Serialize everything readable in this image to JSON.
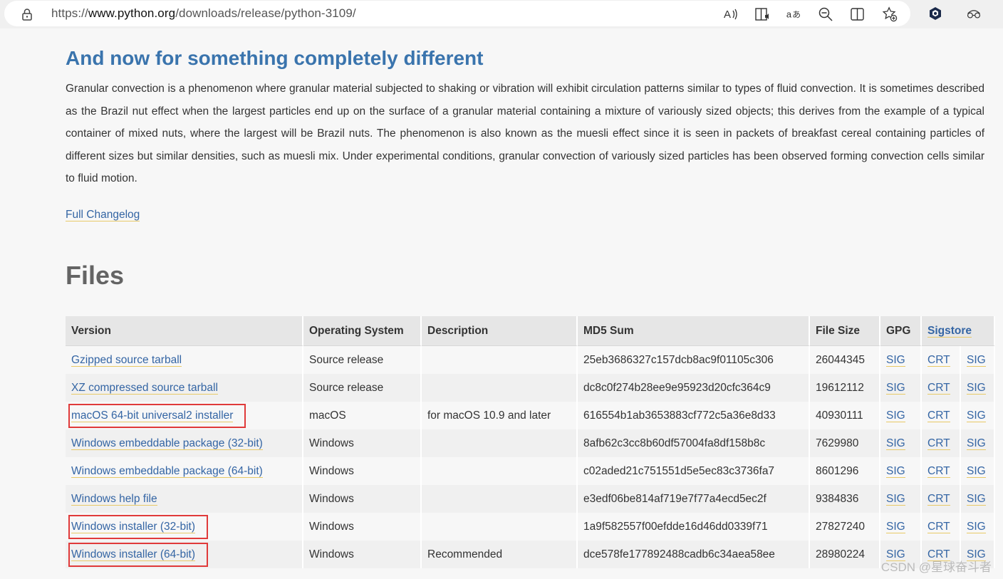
{
  "browser": {
    "url_prefix": "https://",
    "url_domain": "www.python.org",
    "url_path": "/downloads/release/python-3109/",
    "icons": [
      "lock-icon",
      "read-aloud-icon",
      "immersive-reader-icon",
      "translate-icon",
      "zoom-out-icon",
      "split-screen-icon",
      "favorite-add-icon",
      "extension-icon",
      "copilot-icon"
    ]
  },
  "section": {
    "heading": "And now for something completely different",
    "paragraph": "Granular convection is a phenomenon where granular material subjected to shaking or vibration will exhibit circulation patterns similar to types of fluid convection. It is sometimes described as the Brazil nut effect when the largest particles end up on the surface of a granular material containing a mixture of variously sized objects; this derives from the example of a typical container of mixed nuts, where the largest will be Brazil nuts. The phenomenon is also known as the muesli effect since it is seen in packets of breakfast cereal containing particles of different sizes but similar densities, such as muesli mix. Under experimental conditions, granular convection of variously sized particles has been observed forming convection cells similar to fluid motion.",
    "changelog_link": "Full Changelog"
  },
  "files": {
    "heading": "Files",
    "columns": [
      "Version",
      "Operating System",
      "Description",
      "MD5 Sum",
      "File Size",
      "GPG",
      "Sigstore"
    ],
    "rows": [
      {
        "version": "Gzipped source tarball",
        "os": "Source release",
        "description": "",
        "md5": "25eb3686327c157dcb8ac9f01105c306",
        "size": "26044345",
        "gpg": "SIG",
        "crt": "CRT",
        "sig": "SIG",
        "highlighted": false
      },
      {
        "version": "XZ compressed source tarball",
        "os": "Source release",
        "description": "",
        "md5": "dc8c0f274b28ee9e95923d20cfc364c9",
        "size": "19612112",
        "gpg": "SIG",
        "crt": "CRT",
        "sig": "SIG",
        "highlighted": false
      },
      {
        "version": "macOS 64-bit universal2 installer",
        "os": "macOS",
        "description": "for macOS 10.9 and later",
        "md5": "616554b1ab3653883cf772c5a36e8d33",
        "size": "40930111",
        "gpg": "SIG",
        "crt": "CRT",
        "sig": "SIG",
        "highlighted": true
      },
      {
        "version": "Windows embeddable package (32-bit)",
        "os": "Windows",
        "description": "",
        "md5": "8afb62c3cc8b60df57004fa8df158b8c",
        "size": "7629980",
        "gpg": "SIG",
        "crt": "CRT",
        "sig": "SIG",
        "highlighted": false
      },
      {
        "version": "Windows embeddable package (64-bit)",
        "os": "Windows",
        "description": "",
        "md5": "c02aded21c751551d5e5ec83c3736fa7",
        "size": "8601296",
        "gpg": "SIG",
        "crt": "CRT",
        "sig": "SIG",
        "highlighted": false
      },
      {
        "version": "Windows help file",
        "os": "Windows",
        "description": "",
        "md5": "e3edf06be814af719e7f77a4ecd5ec2f",
        "size": "9384836",
        "gpg": "SIG",
        "crt": "CRT",
        "sig": "SIG",
        "highlighted": false
      },
      {
        "version": "Windows installer (32-bit)",
        "os": "Windows",
        "description": "",
        "md5": "1a9f582557f00efdde16d46dd0339f71",
        "size": "27827240",
        "gpg": "SIG",
        "crt": "CRT",
        "sig": "SIG",
        "highlighted": true
      },
      {
        "version": "Windows installer (64-bit)",
        "os": "Windows",
        "description": "Recommended",
        "md5": "dce578fe177892488cadb6c34aea58ee",
        "size": "28980224",
        "gpg": "SIG",
        "crt": "CRT",
        "sig": "SIG",
        "highlighted": true
      }
    ]
  },
  "watermark": "CSDN @星球奋斗者",
  "colors": {
    "link": "#3465a4",
    "heading": "#3a74ad",
    "highlight": "#e03a3a"
  }
}
